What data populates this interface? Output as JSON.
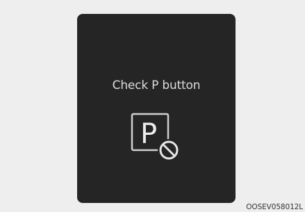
{
  "display": {
    "message": "Check P button",
    "indicator_letter": "P",
    "indicator_icon": "park-button-prohibited-icon"
  },
  "caption": {
    "image_code": "OOSEV058012L"
  },
  "colors": {
    "page_background": "#eeeeee",
    "panel_background": "#252525",
    "text": "#dcdcdc",
    "icon": "#e6e6e6"
  }
}
